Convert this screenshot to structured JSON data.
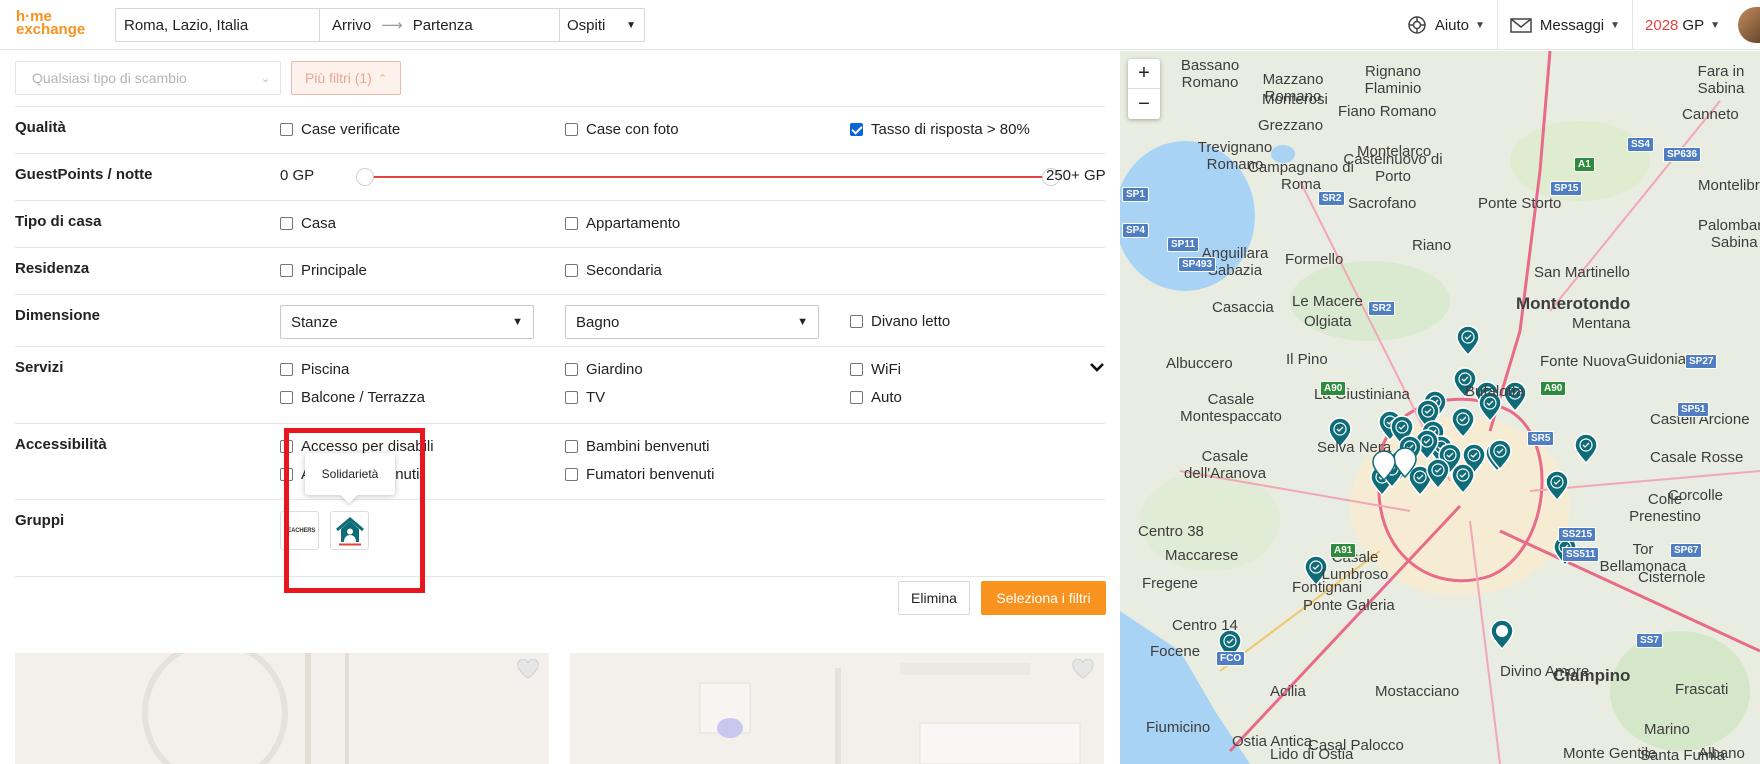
{
  "header": {
    "logo_line1": "h·me",
    "logo_line2": "exchange",
    "location": "Roma, Lazio, Italia",
    "arrival": "Arrivo",
    "departure": "Partenza",
    "guests": "Ospiti",
    "help": "Aiuto",
    "messages": "Messaggi",
    "gp_value": "2028",
    "gp_unit": "GP"
  },
  "filters_bar": {
    "exchange_type_placeholder": "Qualsiasi tipo di scambio",
    "more_filters": "Più filtri (1)"
  },
  "filters": {
    "quality": {
      "label": "Qualità",
      "options": [
        "Case verificate",
        "Case con foto",
        "Tasso di risposta > 80%"
      ],
      "checked": [
        false,
        false,
        true
      ]
    },
    "guestpoints": {
      "label": "GuestPoints / notte",
      "min": "0 GP",
      "max": "250+ GP"
    },
    "home_type": {
      "label": "Tipo di casa",
      "options": [
        "Casa",
        "Appartamento"
      ]
    },
    "residence": {
      "label": "Residenza",
      "options": [
        "Principale",
        "Secondaria"
      ]
    },
    "size": {
      "label": "Dimensione",
      "rooms": "Stanze",
      "bathroom": "Bagno",
      "sofa_bed": "Divano letto"
    },
    "services": {
      "label": "Servizi",
      "options": [
        "Piscina",
        "Giardino",
        "WiFi",
        "Balcone / Terrazza",
        "TV",
        "Auto"
      ]
    },
    "accessibility": {
      "label": "Accessibilità",
      "options": [
        "Accesso per disabili",
        "Animali benvenuti",
        "Bambini benvenuti",
        "Fumatori benvenuti"
      ]
    },
    "groups": {
      "label": "Gruppi",
      "tooltip": "Solidarietà",
      "badge1_text": "TEACHERS"
    }
  },
  "actions": {
    "clear": "Elimina",
    "apply": "Seleziona i filtri"
  },
  "map": {
    "zoom_in": "+",
    "zoom_out": "−",
    "labels": [
      "Bassano Romano",
      "Mazzano Romano",
      "Rignano Flaminio",
      "Fara in Sabina",
      "Monterosi",
      "Grezzano",
      "Fiano Romano",
      "Canneto",
      "Trevignano Romano",
      "Campagnano di Roma",
      "Montelarco",
      "Castelnuovo di Porto",
      "Montelibreti",
      "Sacrofano",
      "Ponte Storto",
      "Palombara Sabina",
      "Anguillara Sabazia",
      "Formello",
      "Riano",
      "San Martinello",
      "Le Macere",
      "Monterotondo",
      "Casaccia",
      "Olgiata",
      "Mentana",
      "Albuccero",
      "Il Pino",
      "Fonte Nuova",
      "Guidonia",
      "La Giustiniana",
      "Bufalotta",
      "Casale Montespaccato",
      "Castell'Arcione",
      "Selva Nera",
      "Casale dell'Aranova",
      "Casale Rosse",
      "Colle Prenestino",
      "Corcolle",
      "Centro 38",
      "Maccarese",
      "Casale Lumbroso",
      "Tor Bellamonaca",
      "Cisternole",
      "Fregene",
      "Fontignani",
      "Ponte Galeria",
      "Centro 14",
      "Focene",
      "Acilia",
      "Mostacciano",
      "Divino Amore",
      "Ciampino",
      "Frascati",
      "Fiumicino",
      "Ostia Antica",
      "Casal Palocco",
      "Marino",
      "Lido di Ostia",
      "Monte Gentile",
      "Santa Fumia",
      "Albano Laziale"
    ],
    "road_shields": [
      "SS4",
      "SP636",
      "A1",
      "SP15",
      "SP1",
      "SR2",
      "SP4",
      "SP11",
      "SP493",
      "SR2",
      "A90",
      "A90",
      "SP27",
      "SP51",
      "SR5",
      "SS215",
      "SS511",
      "SP67",
      "A91",
      "SS7",
      "FCO"
    ]
  }
}
